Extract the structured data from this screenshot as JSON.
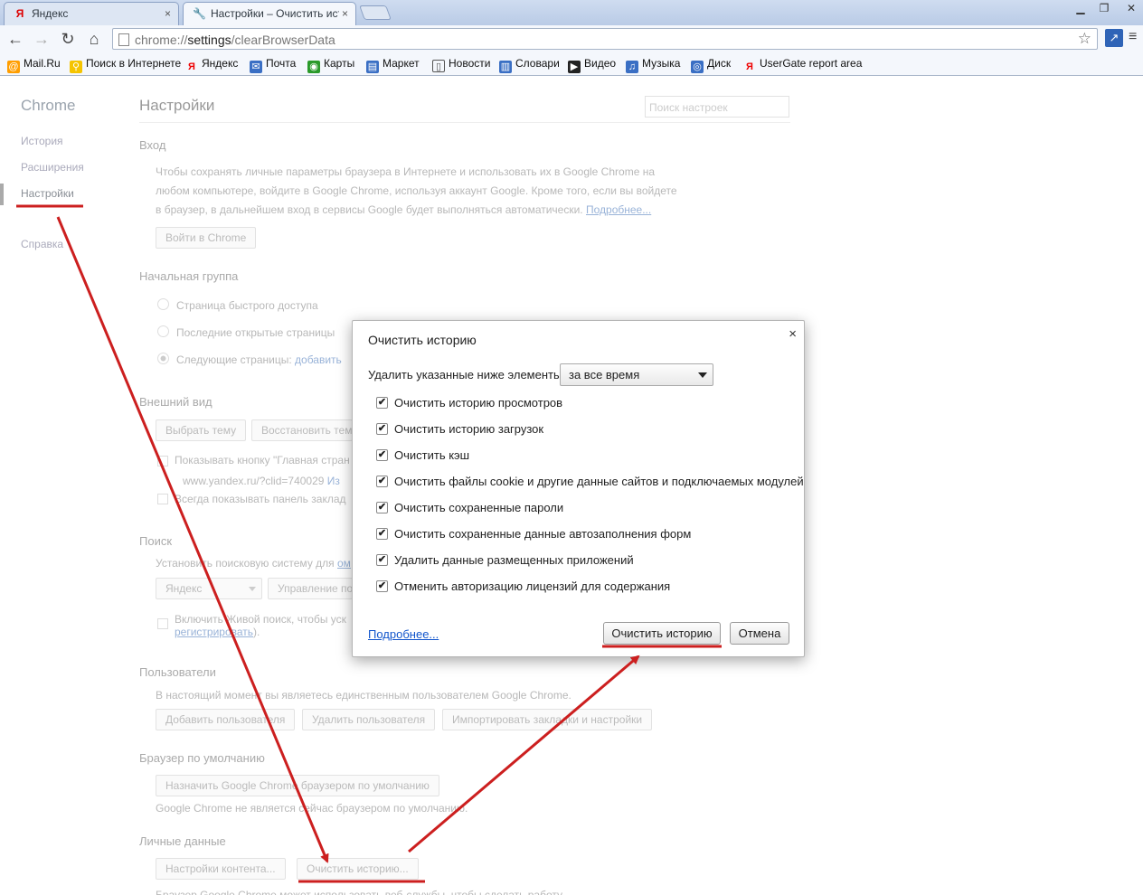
{
  "window": {
    "tabs": [
      {
        "label": "Яндекс",
        "icon": "yandex-favicon",
        "close": "×"
      },
      {
        "label": "Настройки – Очистить ист",
        "icon": "wrench-icon",
        "close": "×"
      }
    ],
    "controls": {
      "minimize": "▁",
      "restore": "❐",
      "close": "✕"
    }
  },
  "toolbar": {
    "url_scheme": "chrome://",
    "url_host": "settings",
    "url_path": "/clearBrowserData"
  },
  "bookmarks": [
    {
      "label": "Mail.Ru",
      "icon": "mailru-icon",
      "color": "#ff9e00"
    },
    {
      "label": "Поиск в Интернете",
      "icon": "search-icon",
      "color": "#f5c400"
    },
    {
      "label": "Яндекс",
      "icon": "yandex-icon",
      "color": "#e00"
    },
    {
      "label": "Почта",
      "icon": "mail-icon",
      "color": "#3a6fc4"
    },
    {
      "label": "Карты",
      "icon": "maps-icon",
      "color": "#2a9a2a"
    },
    {
      "label": "Маркет",
      "icon": "market-icon",
      "color": "#3a6fc4"
    },
    {
      "label": "Новости",
      "icon": "news-icon",
      "color": "#555"
    },
    {
      "label": "Словари",
      "icon": "dictionary-icon",
      "color": "#3a6fc4"
    },
    {
      "label": "Видео",
      "icon": "video-icon",
      "color": "#222"
    },
    {
      "label": "Музыка",
      "icon": "music-icon",
      "color": "#3a6fc4"
    },
    {
      "label": "Диск",
      "icon": "disk-icon",
      "color": "#3a6fc4"
    },
    {
      "label": "UserGate report area",
      "icon": "yandex-icon",
      "color": "#e00"
    }
  ],
  "sidebar": {
    "title": "Chrome",
    "items": [
      "История",
      "Расширения",
      "Настройки",
      "Справка"
    ]
  },
  "settings": {
    "title": "Настройки",
    "search_placeholder": "Поиск настроек",
    "signin": {
      "heading": "Вход",
      "line1": "Чтобы сохранять личные параметры браузера в Интернете и использовать их в Google Chrome на",
      "line2": "любом компьютере, войдите в Google Chrome, используя аккаунт Google. Кроме того, если вы войдете",
      "line3": "в браузер, в дальнейшем вход в сервисы Google будет выполняться автоматически.",
      "more": "Подробнее...",
      "button": "Войти в Chrome"
    },
    "startup": {
      "heading": "Начальная группа",
      "opt1": "Страница быстрого доступа",
      "opt2": "Последние открытые страницы",
      "opt3": "Следующие страницы:",
      "opt3_link": "добавить"
    },
    "appearance": {
      "heading": "Внешний вид",
      "btn_theme": "Выбрать тему",
      "btn_reset": "Восстановить тем",
      "home_btn": "Показывать кнопку \"Главная стран",
      "home_url": "www.yandex.ru/?clid=740029",
      "home_change": "Из",
      "bookmarks_bar": "Всегда показывать панель заклад"
    },
    "search": {
      "heading": "Поиск",
      "text": "Установить поисковую систему для",
      "text_link": "ом",
      "engine": "Яндекс",
      "manage": "Управление по",
      "instant": "Включить Живой поиск, чтобы уск",
      "instant_link": "регистрировать",
      "instant_end": ")."
    },
    "users": {
      "heading": "Пользователи",
      "text": "В настоящий момент вы являетесь единственным пользователем Google Chrome.",
      "btn_add": "Добавить пользователя",
      "btn_delete": "Удалить пользователя",
      "btn_import": "Импортировать закладки и настройки"
    },
    "default_browser": {
      "heading": "Браузер по умолчанию",
      "button": "Назначить Google Chrome браузером по умолчанию",
      "text": "Google Chrome не является сейчас браузером по умолчанию."
    },
    "privacy": {
      "heading": "Личные данные",
      "btn_content": "Настройки контента...",
      "btn_clear": "Очистить историю...",
      "text": "Браузер Google Chrome может использовать веб-службы, чтобы сделать работу"
    }
  },
  "dialog": {
    "title": "Очистить историю",
    "close": "×",
    "range_label": "Удалить указанные ниже элементы:",
    "range_value": "за все время",
    "items": [
      "Очистить историю просмотров",
      "Очистить историю загрузок",
      "Очистить кэш",
      "Очистить файлы cookie и другие данные сайтов и подключаемых модулей",
      "Очистить сохраненные пароли",
      "Очистить сохраненные данные автозаполнения форм",
      "Удалить данные размещенных приложений",
      "Отменить авторизацию лицензий для содержания"
    ],
    "checked": "✔",
    "more": "Подробнее...",
    "confirm": "Очистить историю",
    "cancel": "Отмена"
  },
  "annotation_color": "#cc1f1f"
}
